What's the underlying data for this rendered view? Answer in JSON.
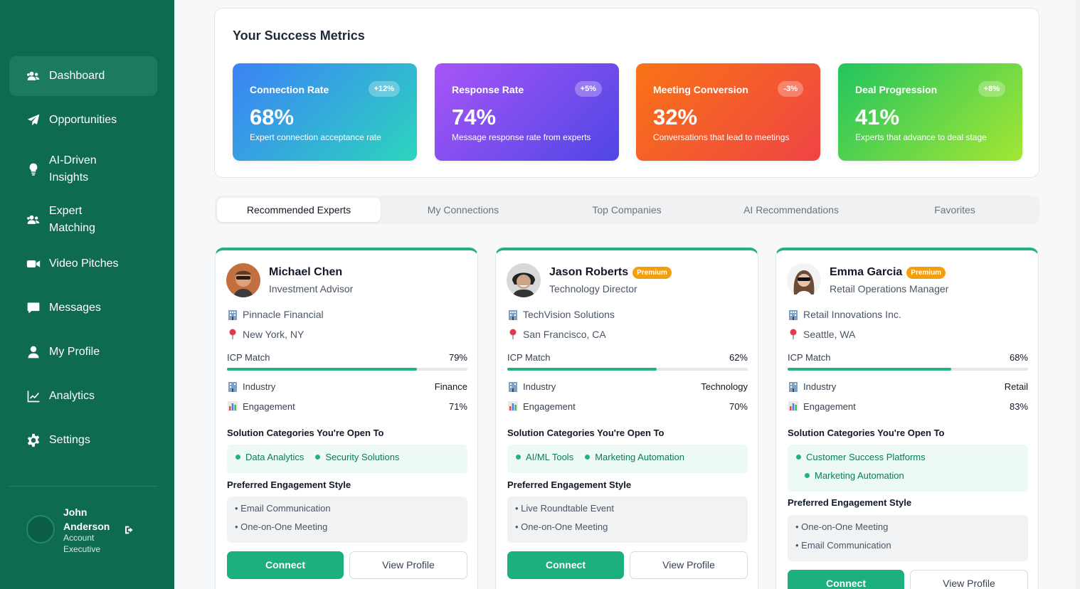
{
  "sidebar": {
    "items": [
      {
        "label": "Dashboard",
        "icon": "users-icon"
      },
      {
        "label": "Opportunities",
        "icon": "paper-plane-icon"
      },
      {
        "label": "AI-Driven Insights",
        "icon": "lightbulb-icon"
      },
      {
        "label": "Expert Matching",
        "icon": "users-icon"
      },
      {
        "label": "Video Pitches",
        "icon": "video-icon"
      },
      {
        "label": "Messages",
        "icon": "message-icon"
      },
      {
        "label": "My Profile",
        "icon": "user-icon"
      },
      {
        "label": "Analytics",
        "icon": "chart-line-icon"
      },
      {
        "label": "Settings",
        "icon": "gear-icon"
      }
    ],
    "user": {
      "name": "John Anderson",
      "role": "Account Executive"
    }
  },
  "metrics": {
    "title": "Your Success Metrics",
    "cards": [
      {
        "title": "Connection Rate",
        "badge": "+12%",
        "value": "68%",
        "desc": "Expert connection acceptance rate",
        "colors": [
          "#3b82f6",
          "#2dd4bf"
        ]
      },
      {
        "title": "Response Rate",
        "badge": "+5%",
        "value": "74%",
        "desc": "Message response rate from experts",
        "colors": [
          "#a855f7",
          "#4f46e5"
        ]
      },
      {
        "title": "Meeting Conversion",
        "badge": "-3%",
        "value": "32%",
        "desc": "Conversations that lead to meetings",
        "colors": [
          "#f97316",
          "#ef4444"
        ]
      },
      {
        "title": "Deal Progression",
        "badge": "+8%",
        "value": "41%",
        "desc": "Experts that advance to deal stage",
        "colors": [
          "#22c55e",
          "#a3e635"
        ]
      }
    ]
  },
  "tabs": [
    "Recommended Experts",
    "My Connections",
    "Top Companies",
    "AI Recommendations",
    "Favorites"
  ],
  "experts": [
    {
      "name": "Michael Chen",
      "premium": "",
      "title": "Investment Advisor",
      "company": "Pinnacle Financial",
      "location": "New York, NY",
      "icp_label": "ICP Match",
      "icp": "79%",
      "icp_value": 0.79,
      "industry_label": "Industry",
      "industry": "Finance",
      "engagement_label": "Engagement",
      "engagement": "71%",
      "sol_title": "Solution Categories You're Open To",
      "solutions": [
        "Data Analytics",
        "Security Solutions"
      ],
      "eng_title": "Preferred Engagement Style",
      "styles": [
        "Email Communication",
        "One-on-One Meeting"
      ],
      "connect": "Connect",
      "view": "View Profile"
    },
    {
      "name": "Jason Roberts",
      "premium": "Premium",
      "title": "Technology Director",
      "company": "TechVision Solutions",
      "location": "San Francisco, CA",
      "icp_label": "ICP Match",
      "icp": "62%",
      "icp_value": 0.62,
      "industry_label": "Industry",
      "industry": "Technology",
      "engagement_label": "Engagement",
      "engagement": "70%",
      "sol_title": "Solution Categories You're Open To",
      "solutions": [
        "AI/ML Tools",
        "Marketing Automation"
      ],
      "eng_title": "Preferred Engagement Style",
      "styles": [
        "Live Roundtable Event",
        "One-on-One Meeting"
      ],
      "connect": "Connect",
      "view": "View Profile"
    },
    {
      "name": "Emma Garcia",
      "premium": "Premium",
      "title": "Retail Operations Manager",
      "company": "Retail Innovations Inc.",
      "location": "Seattle, WA",
      "icp_label": "ICP Match",
      "icp": "68%",
      "icp_value": 0.68,
      "industry_label": "Industry",
      "industry": "Retail",
      "engagement_label": "Engagement",
      "engagement": "83%",
      "sol_title": "Solution Categories You're Open To",
      "solutions": [
        "Customer Success Platforms",
        "Marketing Automation"
      ],
      "eng_title": "Preferred Engagement Style",
      "styles": [
        "One-on-One Meeting",
        "Email Communication"
      ],
      "connect": "Connect",
      "view": "View Profile"
    }
  ]
}
